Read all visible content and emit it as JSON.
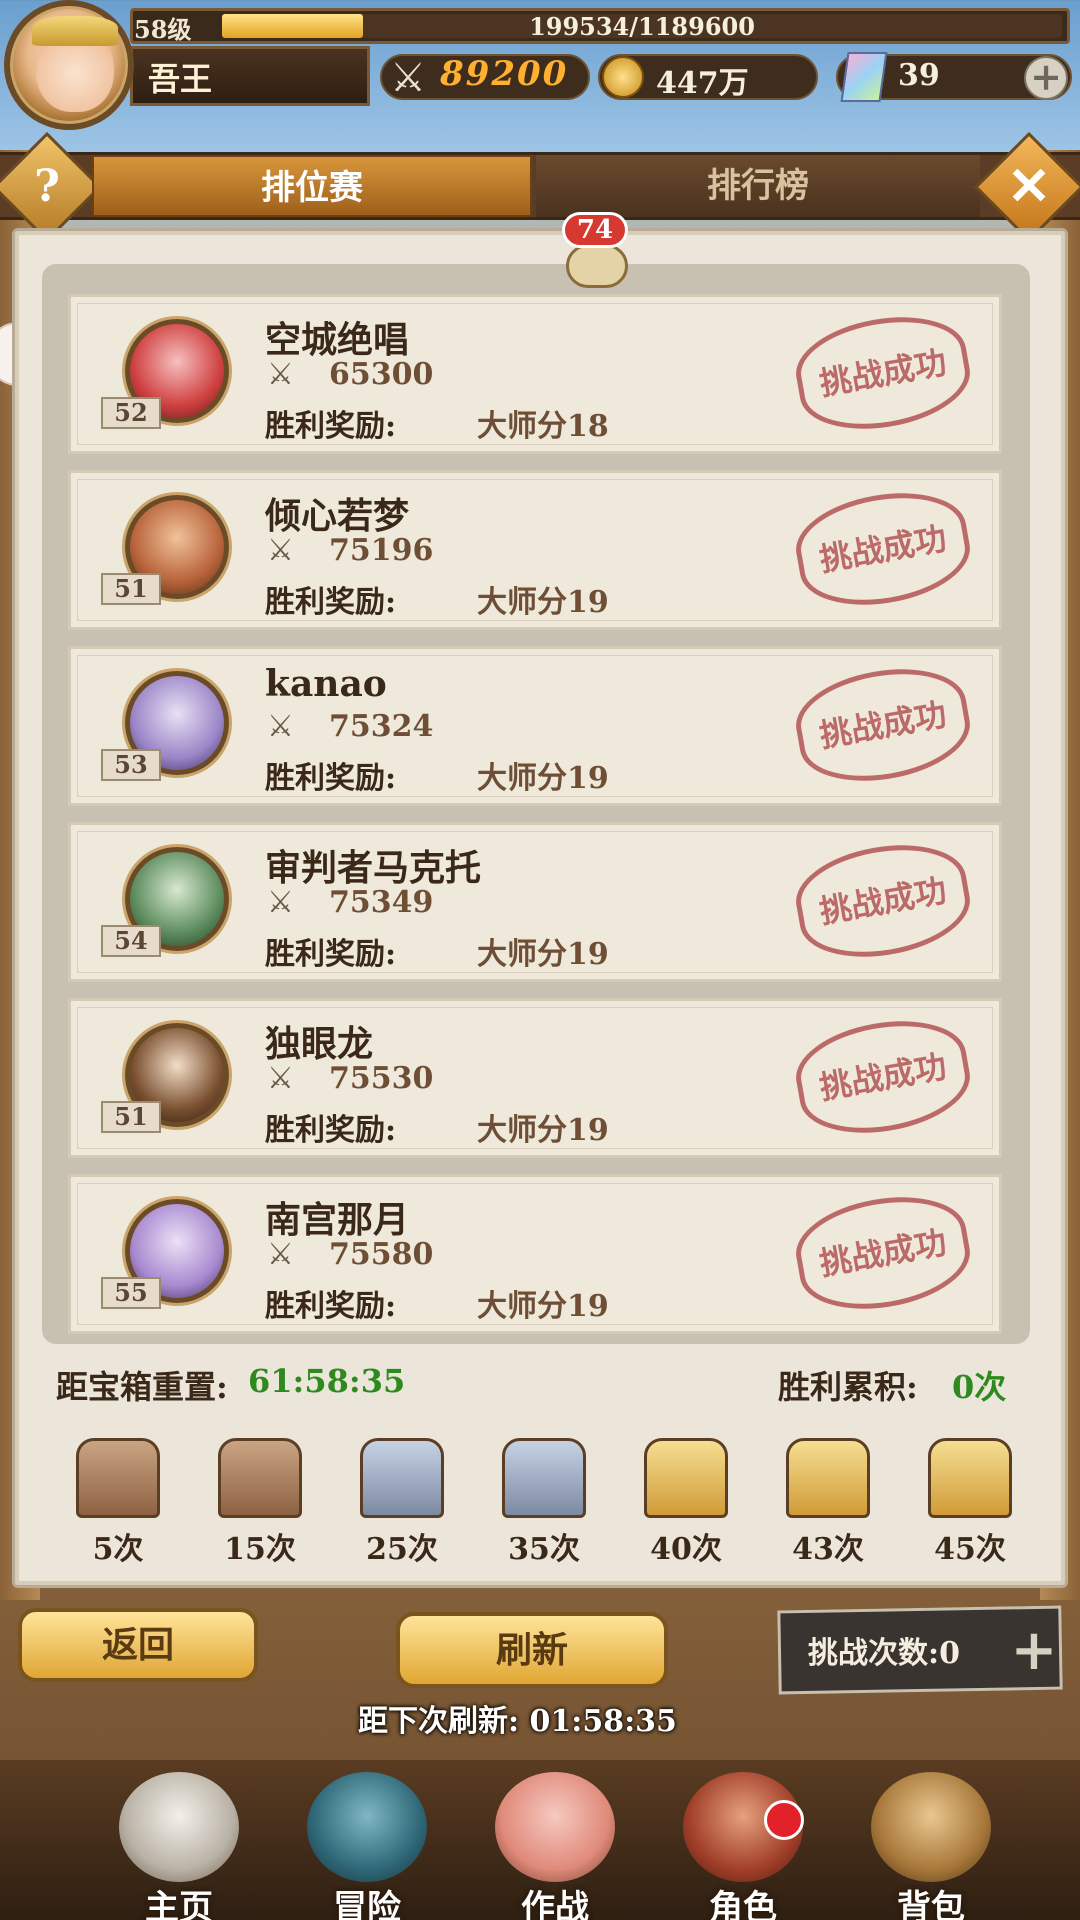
{
  "hud": {
    "level": "58级",
    "exp_text": "199534/1189600",
    "exp_progress": 0.168,
    "player_name": "吾王",
    "power": "89200",
    "gold": "447万",
    "gems": "39"
  },
  "tabs": {
    "active": "排位赛",
    "inactive": "排行榜"
  },
  "chat": {
    "unread": "74"
  },
  "opponents": [
    {
      "name": "空城绝唱",
      "level": "52",
      "power": "65300",
      "reward_label": "胜利奖励:",
      "reward": "大师分18",
      "status": "挑战成功"
    },
    {
      "name": "倾心若梦",
      "level": "51",
      "power": "75196",
      "reward_label": "胜利奖励:",
      "reward": "大师分19",
      "status": "挑战成功"
    },
    {
      "name": "kanao",
      "level": "53",
      "power": "75324",
      "reward_label": "胜利奖励:",
      "reward": "大师分19",
      "status": "挑战成功"
    },
    {
      "name": "审判者马克托",
      "level": "54",
      "power": "75349",
      "reward_label": "胜利奖励:",
      "reward": "大师分19",
      "status": "挑战成功"
    },
    {
      "name": "独眼龙",
      "level": "51",
      "power": "75530",
      "reward_label": "胜利奖励:",
      "reward": "大师分19",
      "status": "挑战成功"
    },
    {
      "name": "南宫那月",
      "level": "55",
      "power": "75580",
      "reward_label": "胜利奖励:",
      "reward": "大师分19",
      "status": "挑战成功"
    }
  ],
  "chest_progress": {
    "reset_label": "距宝箱重置:",
    "reset_time": "61:58:35",
    "wins_label": "胜利累积:",
    "wins_value": "0次",
    "chests": [
      {
        "label": "5次",
        "type": "wood"
      },
      {
        "label": "15次",
        "type": "wood"
      },
      {
        "label": "25次",
        "type": "silver"
      },
      {
        "label": "35次",
        "type": "silver"
      },
      {
        "label": "40次",
        "type": "gold"
      },
      {
        "label": "43次",
        "type": "gold"
      },
      {
        "label": "45次",
        "type": "gold"
      }
    ]
  },
  "actions": {
    "return_label": "返回",
    "refresh_label": "刷新",
    "challenge_label": "挑战次数:0",
    "refresh_timer": "距下次刷新: 01:58:35"
  },
  "nav": {
    "items": [
      {
        "label": "主页",
        "icon": "home-statue-icon"
      },
      {
        "label": "冒险",
        "icon": "adventure-gate-icon"
      },
      {
        "label": "作战",
        "icon": "battle-girl-icon"
      },
      {
        "label": "角色",
        "icon": "character-book-icon"
      },
      {
        "label": "背包",
        "icon": "backpack-icon"
      }
    ]
  },
  "colors": {
    "accent_gold": "#e0a633",
    "stamp_red": "#b45555",
    "timer_green": "#2e8a1f",
    "notify_red": "#e2212a"
  }
}
